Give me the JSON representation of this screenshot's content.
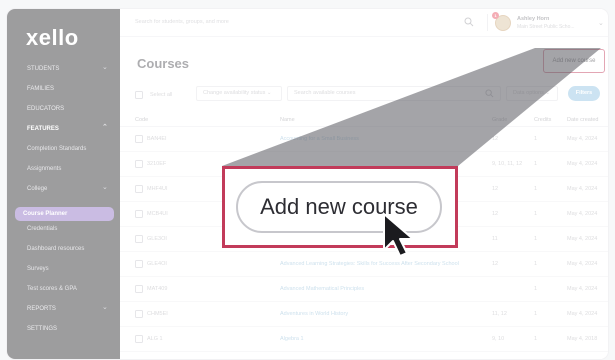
{
  "app": {
    "logo": "xello"
  },
  "sidebar": {
    "items": [
      {
        "label": "STUDENTS",
        "chevron": true,
        "bold": false
      },
      {
        "label": "FAMILIES",
        "chevron": false,
        "bold": false
      },
      {
        "label": "EDUCATORS",
        "chevron": false,
        "bold": false
      },
      {
        "label": "FEATURES",
        "chevron": true,
        "bold": true
      },
      {
        "label": "Completion Standards",
        "sub": true
      },
      {
        "label": "Assignments",
        "sub": true
      },
      {
        "label": "College",
        "sub": true,
        "chevron": true
      },
      {
        "label": "Course Planner",
        "sub": true,
        "active": true
      },
      {
        "label": "Credentials",
        "sub": true
      },
      {
        "label": "Dashboard resources",
        "sub": true
      },
      {
        "label": "Surveys",
        "sub": true
      },
      {
        "label": "Test scores & GPA",
        "sub": true
      },
      {
        "label": "REPORTS",
        "chevron": true
      },
      {
        "label": "SETTINGS"
      }
    ]
  },
  "topbar": {
    "search_placeholder": "Search for students, groups, and more",
    "notification_count": "1",
    "user_name": "Ashley Horn",
    "user_school": "Main Street Public Scho..."
  },
  "page": {
    "title": "Courses",
    "add_button": "Add new course"
  },
  "filters": {
    "select_all": "Select all",
    "availability": "Change availability status",
    "search_placeholder": "Search available courses",
    "data_options": "Data options",
    "filters_button": "Filters"
  },
  "table": {
    "headers": {
      "code": "Code",
      "name": "Name",
      "grade": "Grade",
      "credits": "Credits",
      "date": "Date created"
    },
    "rows": [
      {
        "code": "BAN4EI",
        "name": "Accounting for a Small Business",
        "grade": "12",
        "credits": "1",
        "date": "May 4, 2024"
      },
      {
        "code": "3210EF",
        "name": "",
        "grade": "9, 10, 11, 12",
        "credits": "1",
        "date": "May 4, 2024"
      },
      {
        "code": "MHF4UI",
        "name": "",
        "grade": "12",
        "credits": "1",
        "date": "May 4, 2024"
      },
      {
        "code": "MCB4UI",
        "name": "",
        "grade": "12",
        "credits": "1",
        "date": "May 4, 2024"
      },
      {
        "code": "GLE3OI",
        "name": "",
        "grade": "11",
        "credits": "1",
        "date": "May 4, 2024"
      },
      {
        "code": "GLE4OI",
        "name": "Advanced Learning Strategies: Skills for Success After Secondary School",
        "grade": "12",
        "credits": "1",
        "date": "May 4, 2024"
      },
      {
        "code": "MAT409",
        "name": "Advanced Mathematical Principles",
        "grade": "",
        "credits": "1",
        "date": "May 4, 2024"
      },
      {
        "code": "CHM5EI",
        "name": "Adventures in World History",
        "grade": "11, 12",
        "credits": "1",
        "date": "May 4, 2024"
      },
      {
        "code": "ALG 1",
        "name": "Algebra 1",
        "grade": "9, 10",
        "credits": "1",
        "date": "May 4, 2018"
      }
    ]
  },
  "callout": {
    "zoomed_label": "Add new course",
    "accent": "#c23b5a"
  },
  "colors": {
    "sidebar_bg": "#262629",
    "active_item": "#8a6bc0",
    "filters_button": "#8fc2e2"
  }
}
